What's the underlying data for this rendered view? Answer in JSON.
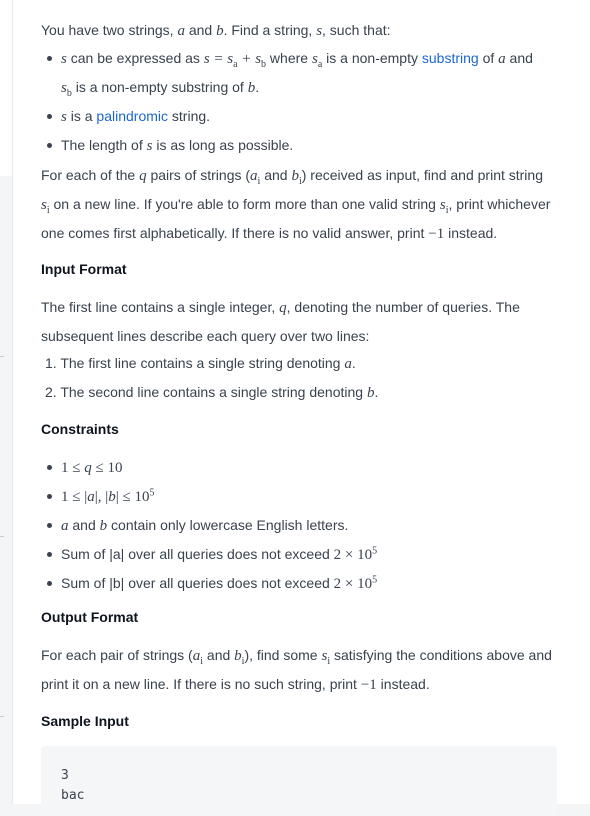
{
  "intro": {
    "p1": "You have two strings, ",
    "a": "a",
    "and": " and ",
    "b": "b",
    "p2": ". Find a string, ",
    "s": "s",
    "p3": ", such that:"
  },
  "bullets": {
    "b1_s": "s",
    "b1_t1": " can be expressed as ",
    "b1_expr": "s = s",
    "b1_sub_a": "a",
    "b1_plus": " + s",
    "b1_sub_b": "b",
    "b1_t2": " where ",
    "b1_sa": "s",
    "b1_sa_sub": "a",
    "b1_t3": " is a non-empty ",
    "b1_link": "substring",
    "b1_t4": " of ",
    "b1_a": "a",
    "b1_t5": " and",
    "b1_sb": "s",
    "b1_sb_sub": "b",
    "b1_t6": " is a non-empty substring of ",
    "b1_b": "b",
    "b1_end": ".",
    "b2_s": "s",
    "b2_t1": " is a ",
    "b2_link": "palindromic",
    "b2_t2": " string.",
    "b3_t1": "The length of ",
    "b3_s": "s",
    "b3_t2": " is as long as possible."
  },
  "para2": {
    "t1": "For each of the ",
    "q": "q",
    "t2": " pairs of strings (",
    "ai": "a",
    "ai_sub": "i",
    "t3": " and ",
    "bi": "b",
    "bi_sub": "i",
    "t4": ") received as input, find and print string",
    "si": "s",
    "si_sub": "i",
    "t5": " on a new line. If you're able to form more than one valid string ",
    "si2": "s",
    "si2_sub": "i",
    "t6": ", print whichever",
    "t7": "one comes first alphabetically. If there is no valid answer, print ",
    "minus1": "−1",
    "t8": " instead."
  },
  "input_format": {
    "heading": "Input Format",
    "l1": "The first line contains a single integer, ",
    "q": "q",
    "l1b": ", denoting the number of queries. The",
    "l2": "subsequent lines describe each query over two lines:",
    "i1": "1. The first line contains a single string denoting ",
    "i1v": "a",
    "i1e": ".",
    "i2": "2. The second line contains a single string denoting ",
    "i2v": "b",
    "i2e": "."
  },
  "constraints": {
    "heading": "Constraints",
    "c1": "1 ≤ ",
    "c1q": "q",
    "c1e": " ≤ 10",
    "c2": "1 ≤ |",
    "c2a": "a",
    "c2m": "|, |",
    "c2b": "b",
    "c2e": "| ≤ 10",
    "c2sup": "5",
    "c3a": "a",
    "c3t1": " and ",
    "c3b": "b",
    "c3t2": " contain only lowercase English letters.",
    "c4": "Sum of |a| over all queries does not exceed ",
    "c4m": "2 × 10",
    "c4sup": "5",
    "c5": "Sum of |b| over all queries does not exceed ",
    "c5m": "2 × 10",
    "c5sup": "5"
  },
  "output_format": {
    "heading": "Output Format",
    "t1": "For each pair of strings (",
    "ai": "a",
    "ai_sub": "i",
    "t2": " and ",
    "bi": "b",
    "bi_sub": "i",
    "t3": "), find some ",
    "si": "s",
    "si_sub": "i",
    "t4": " satisfying the conditions above and",
    "t5": "print it on a new line. If there is no such string, print ",
    "minus1": "−1",
    "t6": " instead."
  },
  "sample_input": {
    "heading": "Sample Input",
    "lines": [
      "3",
      "bac"
    ]
  }
}
